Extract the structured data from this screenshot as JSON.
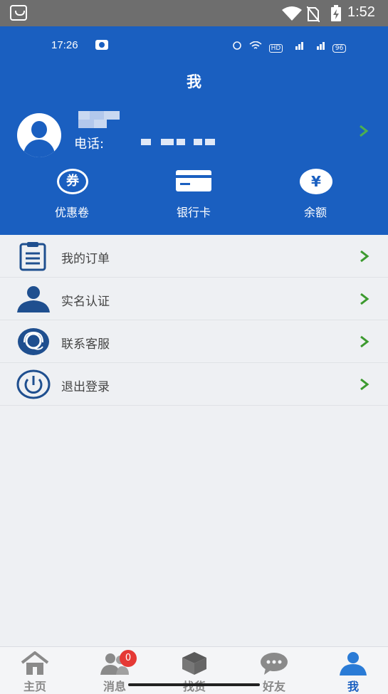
{
  "system_status": {
    "time": "1:52"
  },
  "inner_status": {
    "time": "17:26",
    "network_badge": "HD",
    "battery": "96"
  },
  "header": {
    "title": "我"
  },
  "profile": {
    "phone_label": "电话:"
  },
  "shortcuts": [
    {
      "label": "优惠卷",
      "glyph": "券"
    },
    {
      "label": "银行卡"
    },
    {
      "label": "余额",
      "glyph": "¥"
    }
  ],
  "menu": [
    {
      "label": "我的订单",
      "icon": "clipboard-icon"
    },
    {
      "label": "实名认证",
      "icon": "person-icon"
    },
    {
      "label": "联系客服",
      "icon": "headset-icon"
    },
    {
      "label": "退出登录",
      "icon": "power-icon"
    }
  ],
  "bottom_nav": [
    {
      "label": "主页",
      "icon": "home-icon",
      "active": false
    },
    {
      "label": "消息",
      "icon": "users-icon",
      "badge": "0",
      "active": false
    },
    {
      "label": "找货",
      "icon": "box-icon",
      "active": false
    },
    {
      "label": "好友",
      "icon": "chat-icon",
      "active": false
    },
    {
      "label": "我",
      "icon": "profile-icon",
      "active": true
    }
  ],
  "colors": {
    "primary": "#1a5fc0",
    "chevron": "#3c9a2f",
    "badge": "#e53935",
    "menu_icon": "#1f4f8f"
  }
}
